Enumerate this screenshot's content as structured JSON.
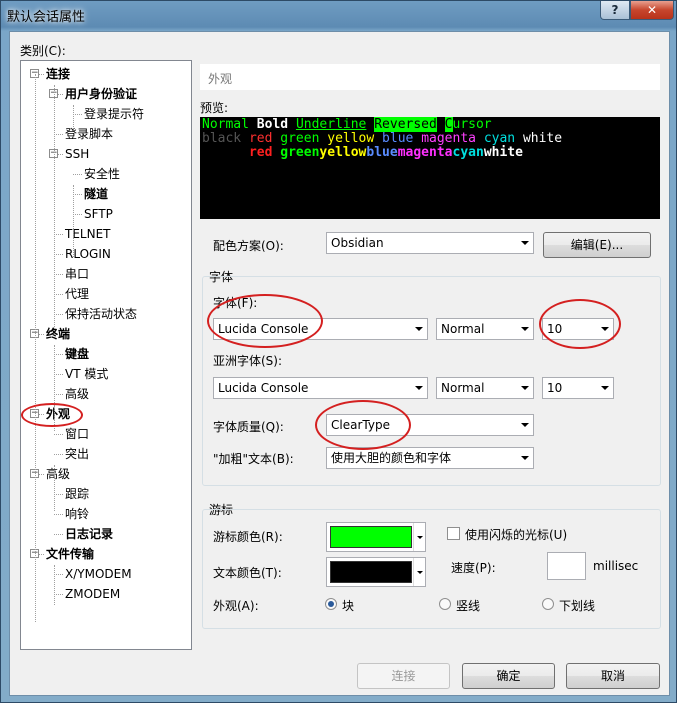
{
  "window": {
    "title": "默认会话属性",
    "buttons": {
      "help": "?",
      "close": "✕"
    }
  },
  "category_label": "类别(C):",
  "tree": [
    {
      "label": "连接",
      "bold": true
    },
    {
      "label": "用户身份验证",
      "bold": true
    },
    {
      "label": "登录提示符",
      "bold": false
    },
    {
      "label": "登录脚本",
      "bold": false
    },
    {
      "label": "SSH",
      "bold": false
    },
    {
      "label": "安全性",
      "bold": false
    },
    {
      "label": "隧道",
      "bold": true
    },
    {
      "label": "SFTP",
      "bold": false
    },
    {
      "label": "TELNET",
      "bold": false
    },
    {
      "label": "RLOGIN",
      "bold": false
    },
    {
      "label": "串口",
      "bold": false
    },
    {
      "label": "代理",
      "bold": false
    },
    {
      "label": "保持活动状态",
      "bold": false
    },
    {
      "label": "终端",
      "bold": true
    },
    {
      "label": "键盘",
      "bold": true
    },
    {
      "label": "VT 模式",
      "bold": false
    },
    {
      "label": "高级",
      "bold": false
    },
    {
      "label": "外观",
      "bold": true
    },
    {
      "label": "窗口",
      "bold": false
    },
    {
      "label": "突出",
      "bold": false
    },
    {
      "label": "高级",
      "bold": false
    },
    {
      "label": "跟踪",
      "bold": false
    },
    {
      "label": "响铃",
      "bold": false
    },
    {
      "label": "日志记录",
      "bold": true
    },
    {
      "label": "文件传输",
      "bold": true
    },
    {
      "label": "X/YMODEM",
      "bold": false
    },
    {
      "label": "ZMODEM",
      "bold": false
    }
  ],
  "section_title": "外观",
  "preview": {
    "label": "预览:",
    "line1": [
      {
        "text": "Normal ",
        "color": "#00ff00",
        "bg": "",
        "bold": false,
        "underline": false
      },
      {
        "text": "Bold",
        "color": "#ffffff",
        "bg": "",
        "bold": true,
        "underline": false
      },
      {
        "text": " ",
        "color": "#00ff00",
        "bg": "",
        "bold": false,
        "underline": false
      },
      {
        "text": "Underline",
        "color": "#00ff00",
        "bg": "",
        "bold": false,
        "underline": true
      },
      {
        "text": " ",
        "color": "#00ff00",
        "bg": "",
        "bold": false,
        "underline": false
      },
      {
        "text": "Reversed",
        "color": "#000000",
        "bg": "#00ff00",
        "bold": false,
        "underline": false
      },
      {
        "text": " ",
        "color": "#00ff00",
        "bg": "",
        "bold": false,
        "underline": false
      },
      {
        "text": "C",
        "color": "#000000",
        "bg": "#00ff00",
        "bold": false,
        "underline": false
      },
      {
        "text": "ursor",
        "color": "#00ff00",
        "bg": "",
        "bold": false,
        "underline": false
      }
    ],
    "line2": [
      {
        "text": "black ",
        "color": "#555555",
        "bold": false
      },
      {
        "text": "red ",
        "color": "#ff3030",
        "bold": false
      },
      {
        "text": "green ",
        "color": "#00ff00",
        "bold": false
      },
      {
        "text": "yellow ",
        "color": "#ffff00",
        "bold": false
      },
      {
        "text": "blue ",
        "color": "#5a8cff",
        "bold": false
      },
      {
        "text": "magenta ",
        "color": "#ff40ff",
        "bold": false
      },
      {
        "text": "cyan ",
        "color": "#00e0e0",
        "bold": false
      },
      {
        "text": "white",
        "color": "#ffffff",
        "bold": false
      }
    ],
    "line3": [
      {
        "text": "      ",
        "color": "#000000",
        "bold": true
      },
      {
        "text": "red ",
        "color": "#ff2020",
        "bold": true
      },
      {
        "text": "green",
        "color": "#00ff00",
        "bold": true
      },
      {
        "text": "yellow",
        "color": "#ffff00",
        "bold": true
      },
      {
        "text": "blue",
        "color": "#5a8cff",
        "bold": true
      },
      {
        "text": "magenta",
        "color": "#ff30ff",
        "bold": true
      },
      {
        "text": "cyan",
        "color": "#00e0e0",
        "bold": true
      },
      {
        "text": "white",
        "color": "#ffffff",
        "bold": true
      }
    ]
  },
  "color_scheme": {
    "label": "配色方案(O):",
    "value": "Obsidian",
    "edit_button": "编辑(E)..."
  },
  "font_group": {
    "title": "字体",
    "font_label": "字体(F):",
    "font_value": "Lucida Console",
    "font_style": "Normal",
    "font_size": "10",
    "asian_label": "亚洲字体(S):",
    "asian_value": "Lucida Console",
    "asian_style": "Normal",
    "asian_size": "10",
    "quality_label": "字体质量(Q):",
    "quality_value": "ClearType",
    "bold_label": "\"加粗\"文本(B):",
    "bold_value": "使用大胆的颜色和字体"
  },
  "cursor_group": {
    "title": "游标",
    "cursor_color_label": "游标颜色(R):",
    "cursor_color": "#00ff00",
    "text_color_label": "文本颜色(T):",
    "text_color": "#000000",
    "blink_label": "使用闪烁的光标(U)",
    "speed_label": "速度(P):",
    "speed_unit": "millisec",
    "appearance_label": "外观(A):",
    "opt_block": "块",
    "opt_vertical": "竖线",
    "opt_underline": "下划线"
  },
  "footer": {
    "connect": "连接",
    "ok": "确定",
    "cancel": "取消"
  },
  "annotation_color": "#d42020"
}
